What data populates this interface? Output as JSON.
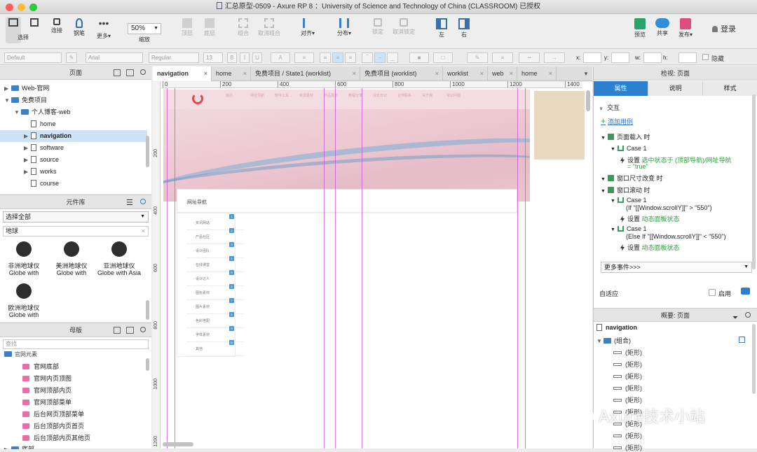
{
  "window": {
    "title": "汇总原型-0509 - Axure RP 8 ：University of Science and Technology of China (CLASSROOM) 已授权"
  },
  "toolbar": {
    "select": "选择",
    "connect": "连接",
    "pen": "钢笔",
    "more": "更多▾",
    "zoom_value": "50%",
    "zoom_label": "缩放",
    "top": "顶层",
    "bottom": "底层",
    "group": "组合",
    "ungroup": "取消组合",
    "align": "对齐▾",
    "distribute": "分布▾",
    "lock": "锁定",
    "unlock": "取消锁定",
    "left": "左",
    "right": "右",
    "preview": "预览",
    "share": "共享",
    "publish": "发布▾",
    "login": "登录"
  },
  "format": {
    "style": "Default",
    "font": "Arial",
    "weight": "Regular",
    "size": "13",
    "x_label": "x:",
    "y_label": "y:",
    "w_label": "w:",
    "h_label": "h:",
    "hidden": "隐藏"
  },
  "pages_panel": {
    "title": "页面",
    "items": [
      {
        "label": "Web-官网",
        "type": "folder",
        "indent": 0
      },
      {
        "label": "免费项目",
        "type": "folder",
        "indent": 0
      },
      {
        "label": "个人博客-web",
        "type": "folder",
        "indent": 1
      },
      {
        "label": "home",
        "type": "page",
        "indent": 2
      },
      {
        "label": "navigation",
        "type": "page",
        "indent": 2,
        "selected": true
      },
      {
        "label": "software",
        "type": "page",
        "indent": 2
      },
      {
        "label": "source",
        "type": "page",
        "indent": 2
      },
      {
        "label": "works",
        "type": "page",
        "indent": 2
      },
      {
        "label": "course",
        "type": "page",
        "indent": 2
      }
    ]
  },
  "library_panel": {
    "title": "元件库",
    "dropdown": "选择全部",
    "search": "地球",
    "widgets": [
      {
        "line1": "非洲地球仪",
        "line2": "Globe with"
      },
      {
        "line1": "美洲地球仪",
        "line2": "Globe with"
      },
      {
        "line1": "亚洲地球仪",
        "line2": "Globe with Asia"
      },
      {
        "line1": "欧洲地球仪",
        "line2": "Globe with"
      }
    ]
  },
  "masters_panel": {
    "title": "母版",
    "search_placeholder": "查找",
    "folder": "官网元素",
    "items": [
      "官网底部",
      "官网内页顶图",
      "官网顶部内页",
      "官网顶部菜单",
      "后台网页顶部菜单",
      "后台顶部内页首页",
      "后台顶部内页其他页"
    ],
    "folder2": "底部"
  },
  "tabs": [
    {
      "label": "navigation",
      "active": true
    },
    {
      "label": "home"
    },
    {
      "label": "免费项目 / State1 (worklist)"
    },
    {
      "label": "免费项目 (worklist)"
    },
    {
      "label": "worklist"
    },
    {
      "label": "web"
    },
    {
      "label": "home"
    }
  ],
  "ruler": {
    "h": [
      "0",
      "200",
      "400",
      "600",
      "800",
      "1000",
      "1200",
      "1400"
    ],
    "v": [
      "200",
      "400",
      "600",
      "800",
      "1000",
      "1200"
    ]
  },
  "canvas": {
    "nav_items": [
      "首页",
      "网址导航",
      "软件工具",
      "资源素材",
      "作品展示",
      "教程分享",
      "成长日记",
      "合作联系",
      "关于我",
      "常识问题"
    ],
    "panel_title": "网址导航",
    "side_items": [
      "· 资讯网站",
      "· 产品社区",
      "· 设计团队",
      "· 在线课堂",
      "· 设计达人",
      "· 图标素材",
      "· 图片素材",
      "· 色彩搭配",
      "· 字体素材",
      "· 其他"
    ],
    "badges": [
      "1",
      "2",
      "3",
      "4",
      "5",
      "6",
      "7",
      "8",
      "9",
      "10"
    ]
  },
  "inspector": {
    "title": "检视: 页面",
    "tabs": [
      "属性",
      "说明",
      "样式"
    ],
    "interaction": "交互",
    "add_case": "添加用例",
    "events": [
      {
        "kind": "event",
        "text": "页面载入 时",
        "indent": 0
      },
      {
        "kind": "case",
        "text": "Case 1",
        "indent": 1
      },
      {
        "kind": "action",
        "prefix": "设置 ",
        "text": "选中状态于 (顶部导航)/网址导航",
        "indent": 2
      },
      {
        "kind": "cont",
        "text": "= \"true\"",
        "indent": 2
      },
      {
        "kind": "event",
        "text": "窗口尺寸改变 时",
        "indent": 0
      },
      {
        "kind": "event",
        "text": "窗口滚动 时",
        "indent": 0
      },
      {
        "kind": "case",
        "text": "Case 1",
        "indent": 1
      },
      {
        "kind": "cond",
        "text": "(If \"[[Window.scrollY]]\" > \"550\")",
        "indent": 1
      },
      {
        "kind": "action",
        "prefix": "设置 ",
        "text": "动态面板状态",
        "indent": 2
      },
      {
        "kind": "case",
        "text": "Case 1",
        "indent": 1
      },
      {
        "kind": "cond",
        "text": "(Else If \"[[Window.scrollY]]\" < \"550\")",
        "indent": 1
      },
      {
        "kind": "action",
        "prefix": "设置 ",
        "text": "动态面板状态",
        "indent": 2
      }
    ],
    "more_events": "更多事件>>>",
    "adaptive": "自适应",
    "enable": "启用"
  },
  "outline": {
    "title": "概要: 页面",
    "page": "navigation",
    "group": "(组合)",
    "rects": [
      "(矩形)",
      "(矩形)",
      "(矩形)",
      "(矩形)",
      "(矩形)",
      "(矩形)",
      "(矩形)",
      "(矩形)",
      "(矩形)"
    ]
  },
  "watermark": "Axure技术小站"
}
